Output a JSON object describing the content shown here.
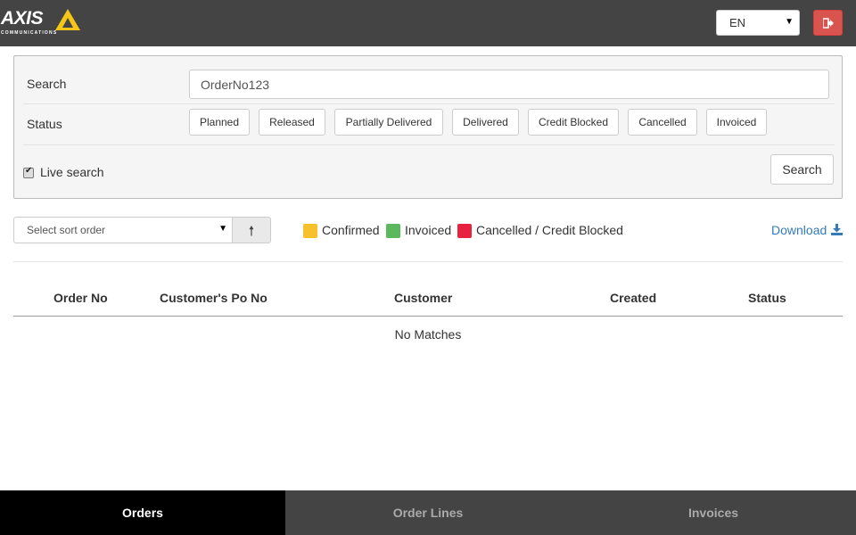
{
  "brand": {
    "name": "AXIS",
    "tagline": "COMMUNICATIONS",
    "accent": "#f5c518"
  },
  "header": {
    "language": "EN"
  },
  "filters": {
    "search_label": "Search",
    "search_value": "OrderNo123",
    "status_label": "Status",
    "statuses": [
      "Planned",
      "Released",
      "Partially Delivered",
      "Delivered",
      "Credit Blocked",
      "Cancelled",
      "Invoiced"
    ],
    "live_search_label": "Live search",
    "live_search_checked": true,
    "search_button": "Search"
  },
  "toolbar": {
    "sort_placeholder": "Select sort order",
    "sort_direction_icon": "arrow-up",
    "legend": [
      {
        "label": "Confirmed",
        "color": "#f7c02d"
      },
      {
        "label": "Invoiced",
        "color": "#5cb85c"
      },
      {
        "label": "Cancelled / Credit Blocked",
        "color": "#e8213f"
      }
    ],
    "download_label": "Download"
  },
  "table": {
    "columns": [
      "Order No",
      "Customer's Po No",
      "Customer",
      "Created",
      "Status"
    ],
    "empty_text": "No Matches"
  },
  "tabs": [
    "Orders",
    "Order Lines",
    "Invoices"
  ],
  "active_tab": "Orders"
}
